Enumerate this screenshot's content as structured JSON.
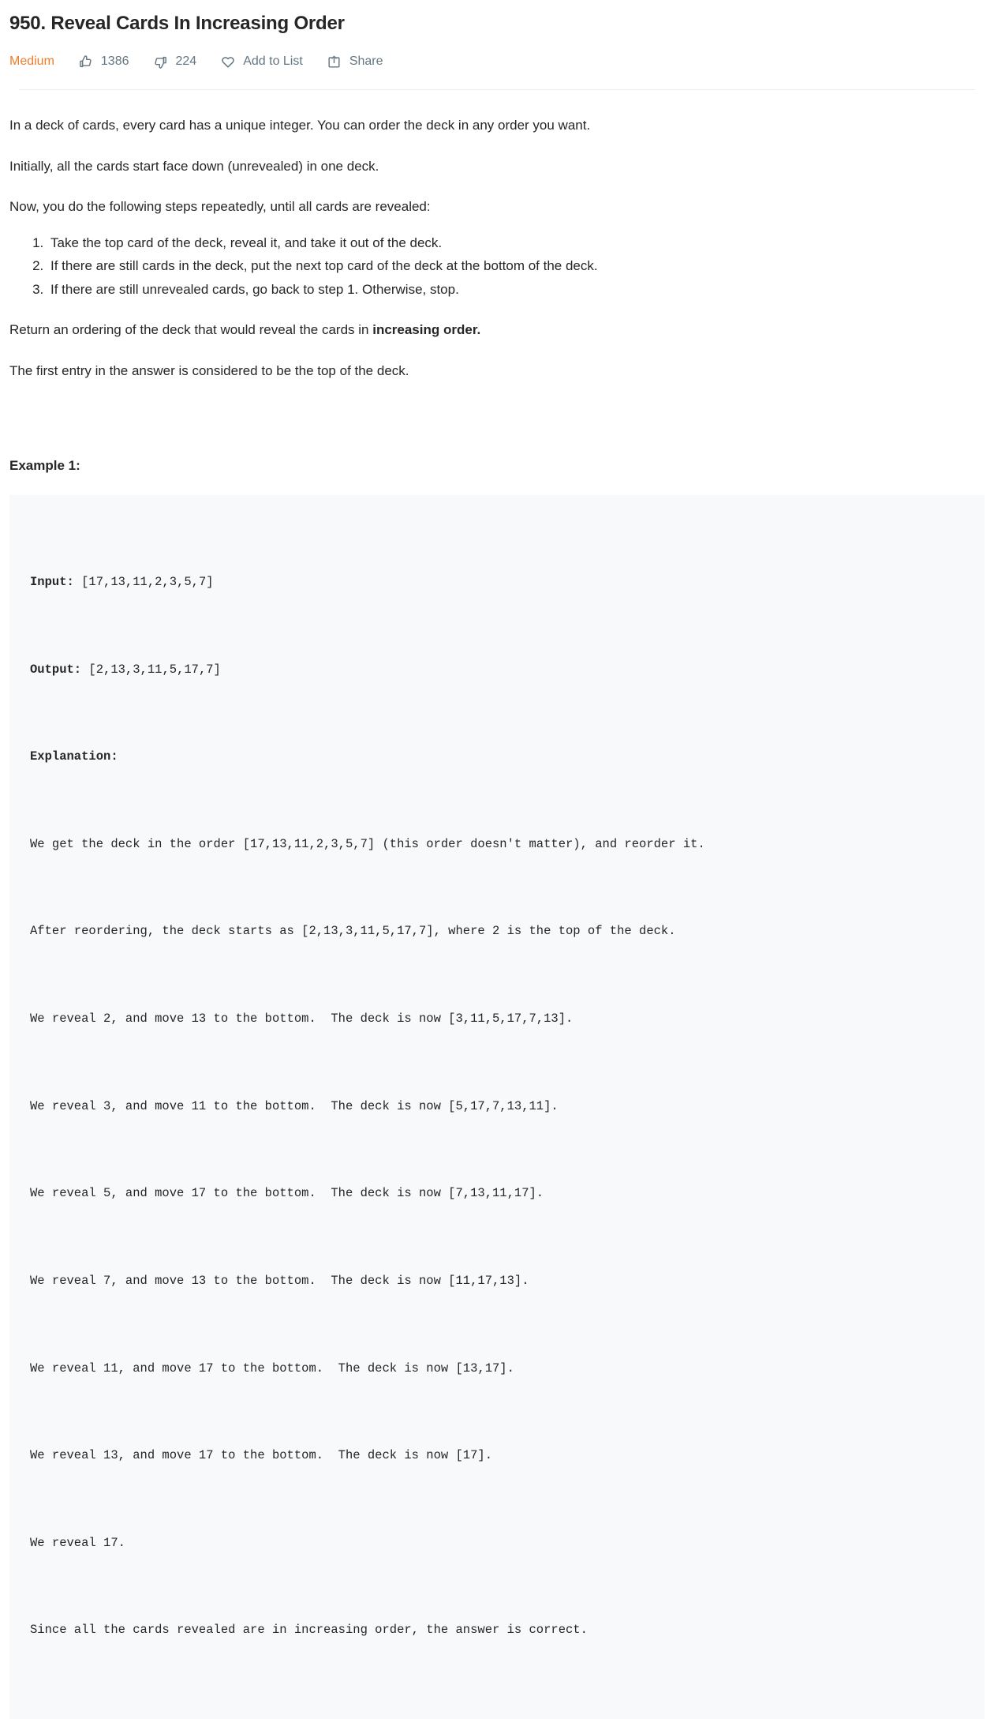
{
  "problem": {
    "title": "950. Reveal Cards In Increasing Order",
    "difficulty": "Medium",
    "likes": "1386",
    "dislikes": "224",
    "add_to_list_label": "Add to List",
    "share_label": "Share"
  },
  "description": {
    "paragraph_1": "In a deck of cards, every card has a unique integer.  You can order the deck in any order you want.",
    "paragraph_2": "Initially, all the cards start face down (unrevealed) in one deck.",
    "paragraph_3": "Now, you do the following steps repeatedly, until all cards are revealed:",
    "steps": [
      "Take the top card of the deck, reveal it, and take it out of the deck.",
      "If there are still cards in the deck, put the next top card of the deck at the bottom of the deck.",
      "If there are still unrevealed cards, go back to step 1.  Otherwise, stop."
    ],
    "paragraph_4_prefix": "Return an ordering of the deck that would reveal the cards in ",
    "paragraph_4_bold": "increasing order.",
    "paragraph_5": "The first entry in the answer is considered to be the top of the deck."
  },
  "example": {
    "heading": "Example 1:",
    "input_label": "Input:",
    "input_value": " [17,13,11,2,3,5,7]",
    "output_label": "Output:",
    "output_value": " [2,13,3,11,5,17,7]",
    "explanation_label": "Explanation:",
    "explanation_lines": [
      "We get the deck in the order [17,13,11,2,3,5,7] (this order doesn't matter), and reorder it.",
      "After reordering, the deck starts as [2,13,3,11,5,17,7], where 2 is the top of the deck.",
      "We reveal 2, and move 13 to the bottom.  The deck is now [3,11,5,17,7,13].",
      "We reveal 3, and move 11 to the bottom.  The deck is now [5,17,7,13,11].",
      "We reveal 5, and move 17 to the bottom.  The deck is now [7,13,11,17].",
      "We reveal 7, and move 13 to the bottom.  The deck is now [11,17,13].",
      "We reveal 11, and move 17 to the bottom.  The deck is now [13,17].",
      "We reveal 13, and move 17 to the bottom.  The deck is now [17].",
      "We reveal 17.",
      "Since all the cards revealed are in increasing order, the answer is correct."
    ]
  },
  "icons": {
    "like": "thumbs-up-icon",
    "dislike": "thumbs-down-icon",
    "add_to_list": "heart-icon",
    "share": "share-icon"
  },
  "colors": {
    "difficulty_medium": "#ef7c29",
    "meta_text": "#647682",
    "body_text": "#262626",
    "code_background": "#f7f9fa",
    "divider": "#ededed"
  }
}
